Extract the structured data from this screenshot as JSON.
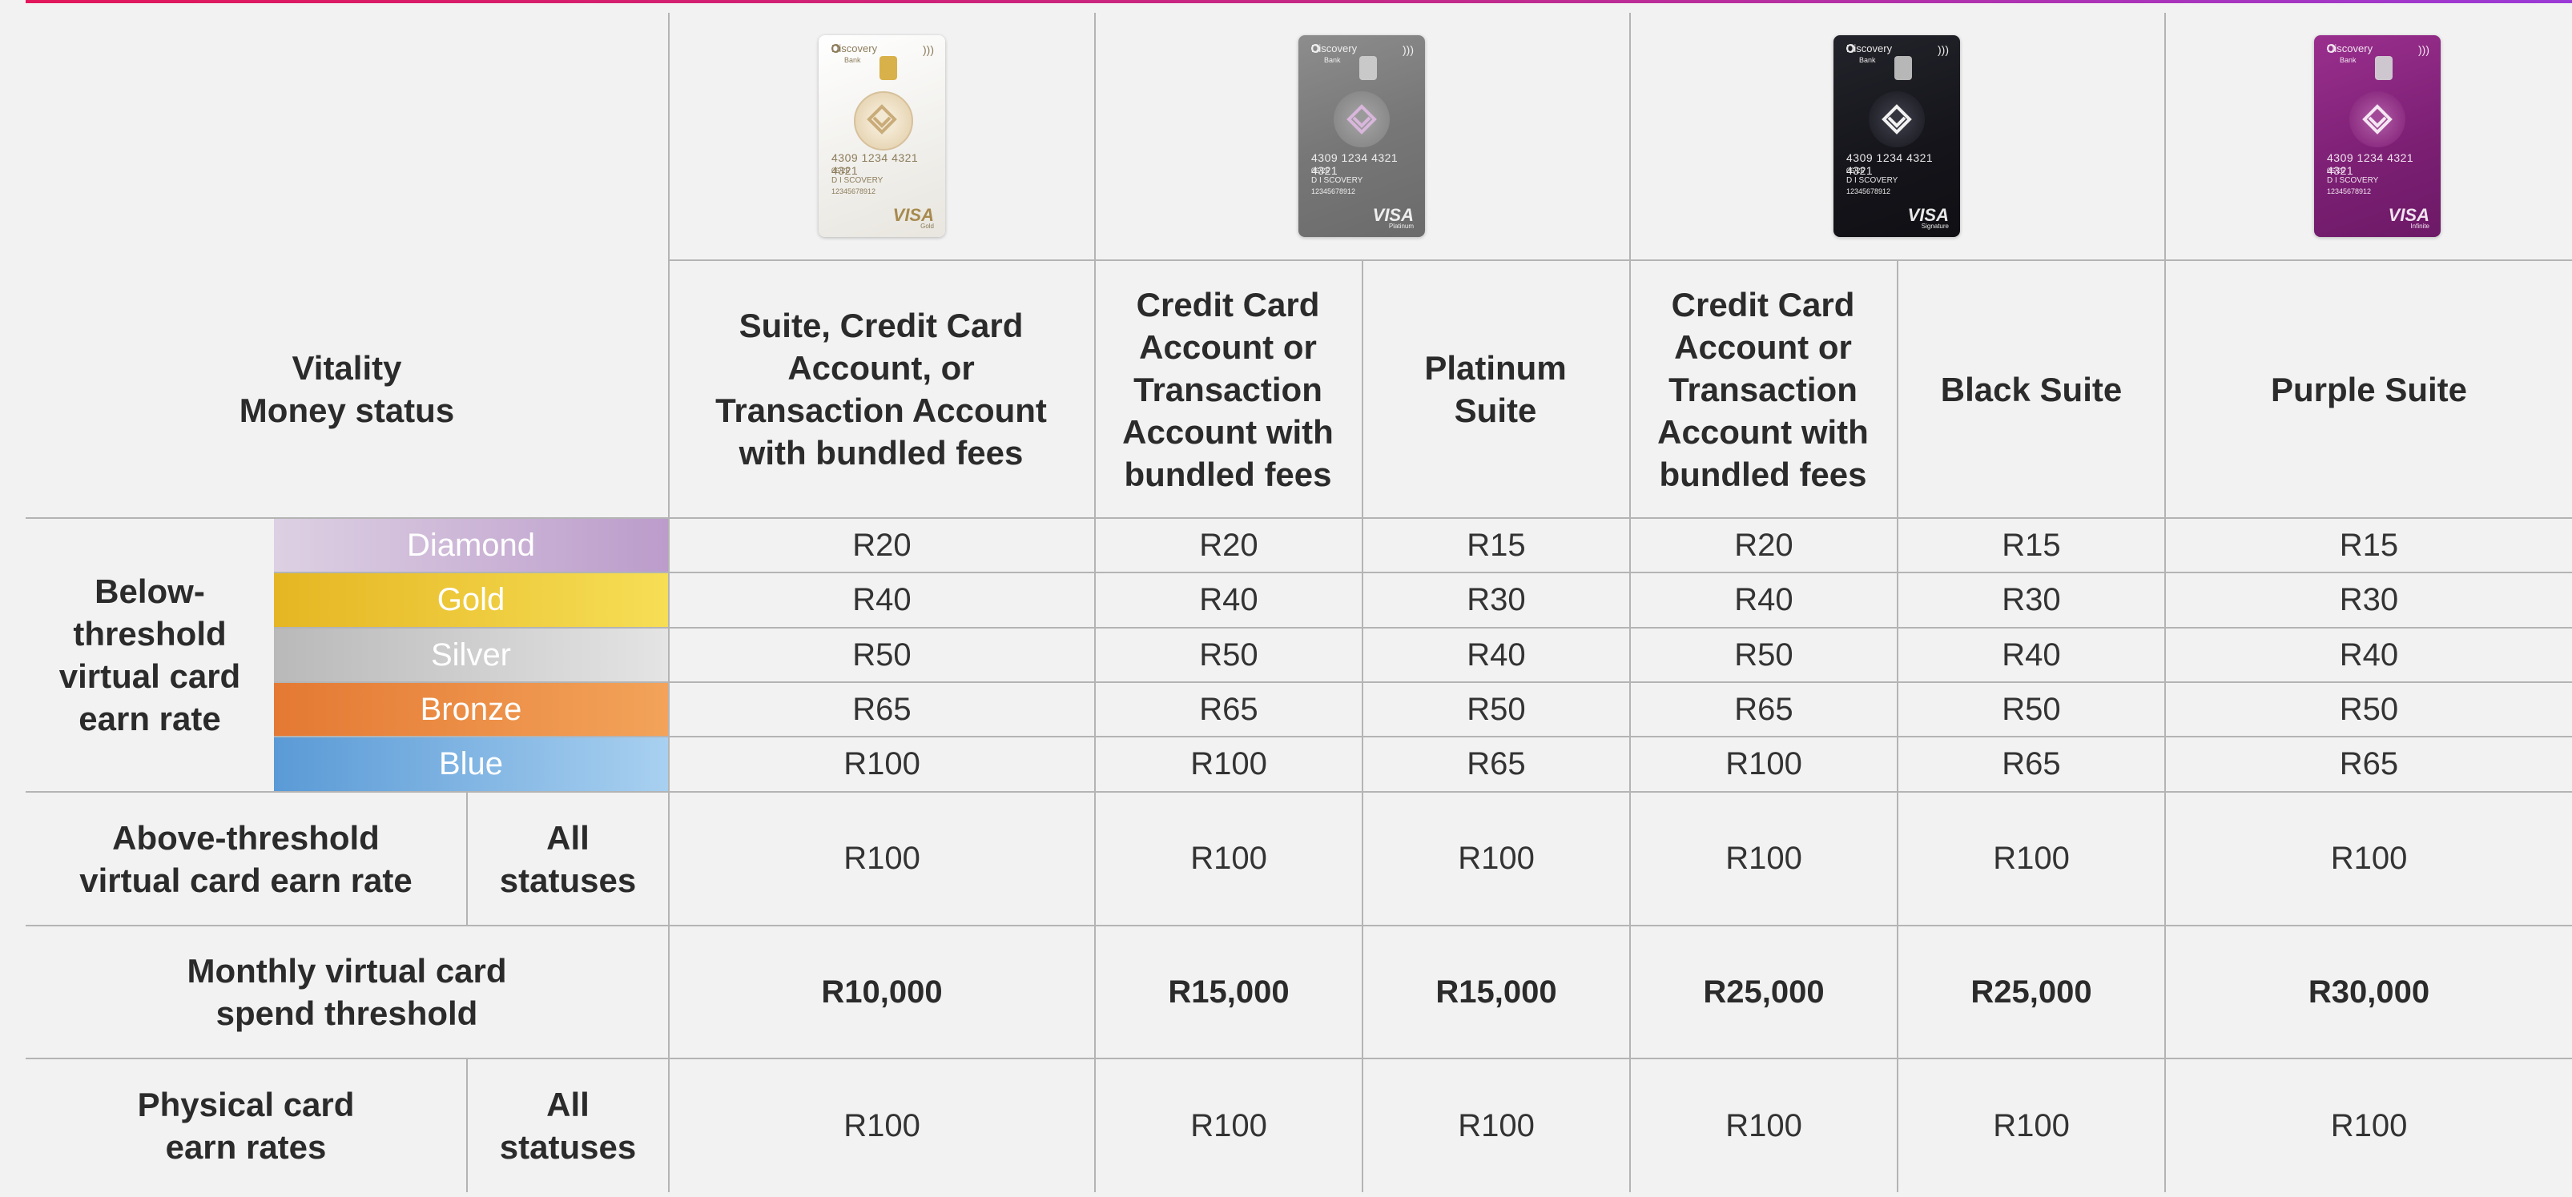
{
  "header": {
    "status_label": "Vitality\nMoney status"
  },
  "columns": [
    "Suite, Credit Card Account, or Transaction Account with bundled fees",
    "Credit Card Account or Transaction Account with bundled fees",
    "Platinum Suite",
    "Credit Card Account or Transaction Account with bundled fees",
    "Black Suite",
    "Purple Suite"
  ],
  "cards": [
    {
      "brand": "Discovery",
      "sub": "Bank",
      "number": "4309 1234 4321 4321",
      "expiry": "06/26",
      "holder": "D I SCOVERY",
      "account": "12345678912",
      "network": "VISA",
      "tier": "Gold"
    },
    {
      "brand": "Discovery",
      "sub": "Bank",
      "number": "4309 1234 4321 4321",
      "expiry": "06/26",
      "holder": "D I SCOVERY",
      "account": "12345678912",
      "network": "VISA",
      "tier": "Platinum"
    },
    {
      "brand": "Discovery",
      "sub": "Bank",
      "number": "4309 1234 4321 4321",
      "expiry": "06/26",
      "holder": "D I SCOVERY",
      "account": "12345678912",
      "network": "VISA",
      "tier": "Signature"
    },
    {
      "brand": "Discovery",
      "sub": "Bank",
      "number": "4309 1234 4321 4321",
      "expiry": "06/26",
      "holder": "D I SCOVERY",
      "account": "12345678912",
      "network": "VISA",
      "tier": "Infinite"
    }
  ],
  "below_threshold": {
    "label": "Below-\nthreshold\nvirtual card\nearn rate",
    "tiers": [
      {
        "name": "Diamond",
        "values": [
          "R20",
          "R20",
          "R15",
          "R20",
          "R15",
          "R15"
        ]
      },
      {
        "name": "Gold",
        "values": [
          "R40",
          "R40",
          "R30",
          "R40",
          "R30",
          "R30"
        ]
      },
      {
        "name": "Silver",
        "values": [
          "R50",
          "R50",
          "R40",
          "R50",
          "R40",
          "R40"
        ]
      },
      {
        "name": "Bronze",
        "values": [
          "R65",
          "R65",
          "R50",
          "R65",
          "R50",
          "R50"
        ]
      },
      {
        "name": "Blue",
        "values": [
          "R100",
          "R100",
          "R65",
          "R100",
          "R65",
          "R65"
        ]
      }
    ]
  },
  "above_threshold": {
    "label": "Above-threshold\nvirtual card earn rate",
    "status": "All\nstatuses",
    "values": [
      "R100",
      "R100",
      "R100",
      "R100",
      "R100",
      "R100"
    ]
  },
  "monthly_threshold": {
    "label": "Monthly virtual card\nspend threshold",
    "values": [
      "R10,000",
      "R15,000",
      "R15,000",
      "R25,000",
      "R25,000",
      "R30,000"
    ]
  },
  "physical": {
    "label": "Physical card\nearn rates",
    "status": "All\nstatuses",
    "values": [
      "R100",
      "R100",
      "R100",
      "R100",
      "R100",
      "R100"
    ]
  },
  "colors": {
    "accent_start": "#e2175b",
    "accent_end": "#9b3ad6",
    "diamond": "#bc9ccb",
    "gold": "#f2cf3f",
    "silver": "#d4d4d4",
    "bronze": "#ee8a42",
    "blue": "#7fb6e6"
  }
}
